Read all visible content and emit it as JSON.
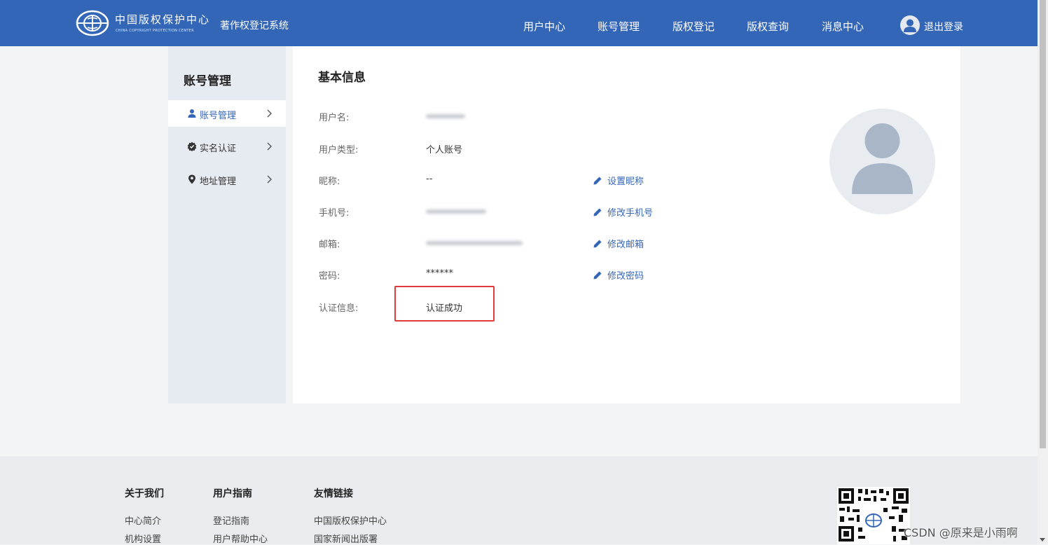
{
  "header": {
    "logo_cn": "中国版权保护中心",
    "logo_en": "CHINA COPYRIGHT PROTECTION CENTER",
    "system_name": "著作权登记系统",
    "nav": [
      {
        "label": "用户中心"
      },
      {
        "label": "账号管理"
      },
      {
        "label": "版权登记"
      },
      {
        "label": "版权查询"
      },
      {
        "label": "消息中心"
      }
    ],
    "logout_label": "退出登录"
  },
  "sidebar": {
    "title": "账号管理",
    "items": [
      {
        "label": "账号管理",
        "icon": "user-icon",
        "active": true
      },
      {
        "label": "实名认证",
        "icon": "badge-icon",
        "active": false
      },
      {
        "label": "地址管理",
        "icon": "location-pin-icon",
        "active": false
      }
    ]
  },
  "main": {
    "title": "基本信息",
    "fields": [
      {
        "label": "用户名:",
        "value": "",
        "blurred": true
      },
      {
        "label": "用户类型:",
        "value": "个人账号"
      },
      {
        "label": "昵称:",
        "value": "--",
        "action": "设置昵称"
      },
      {
        "label": "手机号:",
        "value": "",
        "blurred": true,
        "action": "修改手机号"
      },
      {
        "label": "邮箱:",
        "value": "",
        "blurred": true,
        "action": "修改邮箱"
      },
      {
        "label": "密码:",
        "value": "******",
        "action": "修改密码"
      },
      {
        "label": "认证信息:",
        "value": "认证成功"
      }
    ],
    "highlight_color": "#e03c3c"
  },
  "footer": {
    "columns": [
      {
        "title": "关于我们",
        "links": [
          "中心简介",
          "机构设置"
        ]
      },
      {
        "title": "用户指南",
        "links": [
          "登记指南",
          "用户帮助中心"
        ]
      },
      {
        "title": "友情链接",
        "links": [
          "中国版权保护中心",
          "国家新闻出版署"
        ]
      }
    ],
    "watermark": "CSDN @原来是小雨啊"
  },
  "colors": {
    "brand": "#3466b8",
    "sidebar_bg": "#e6ebf2",
    "page_bg": "#f3f4f6"
  }
}
